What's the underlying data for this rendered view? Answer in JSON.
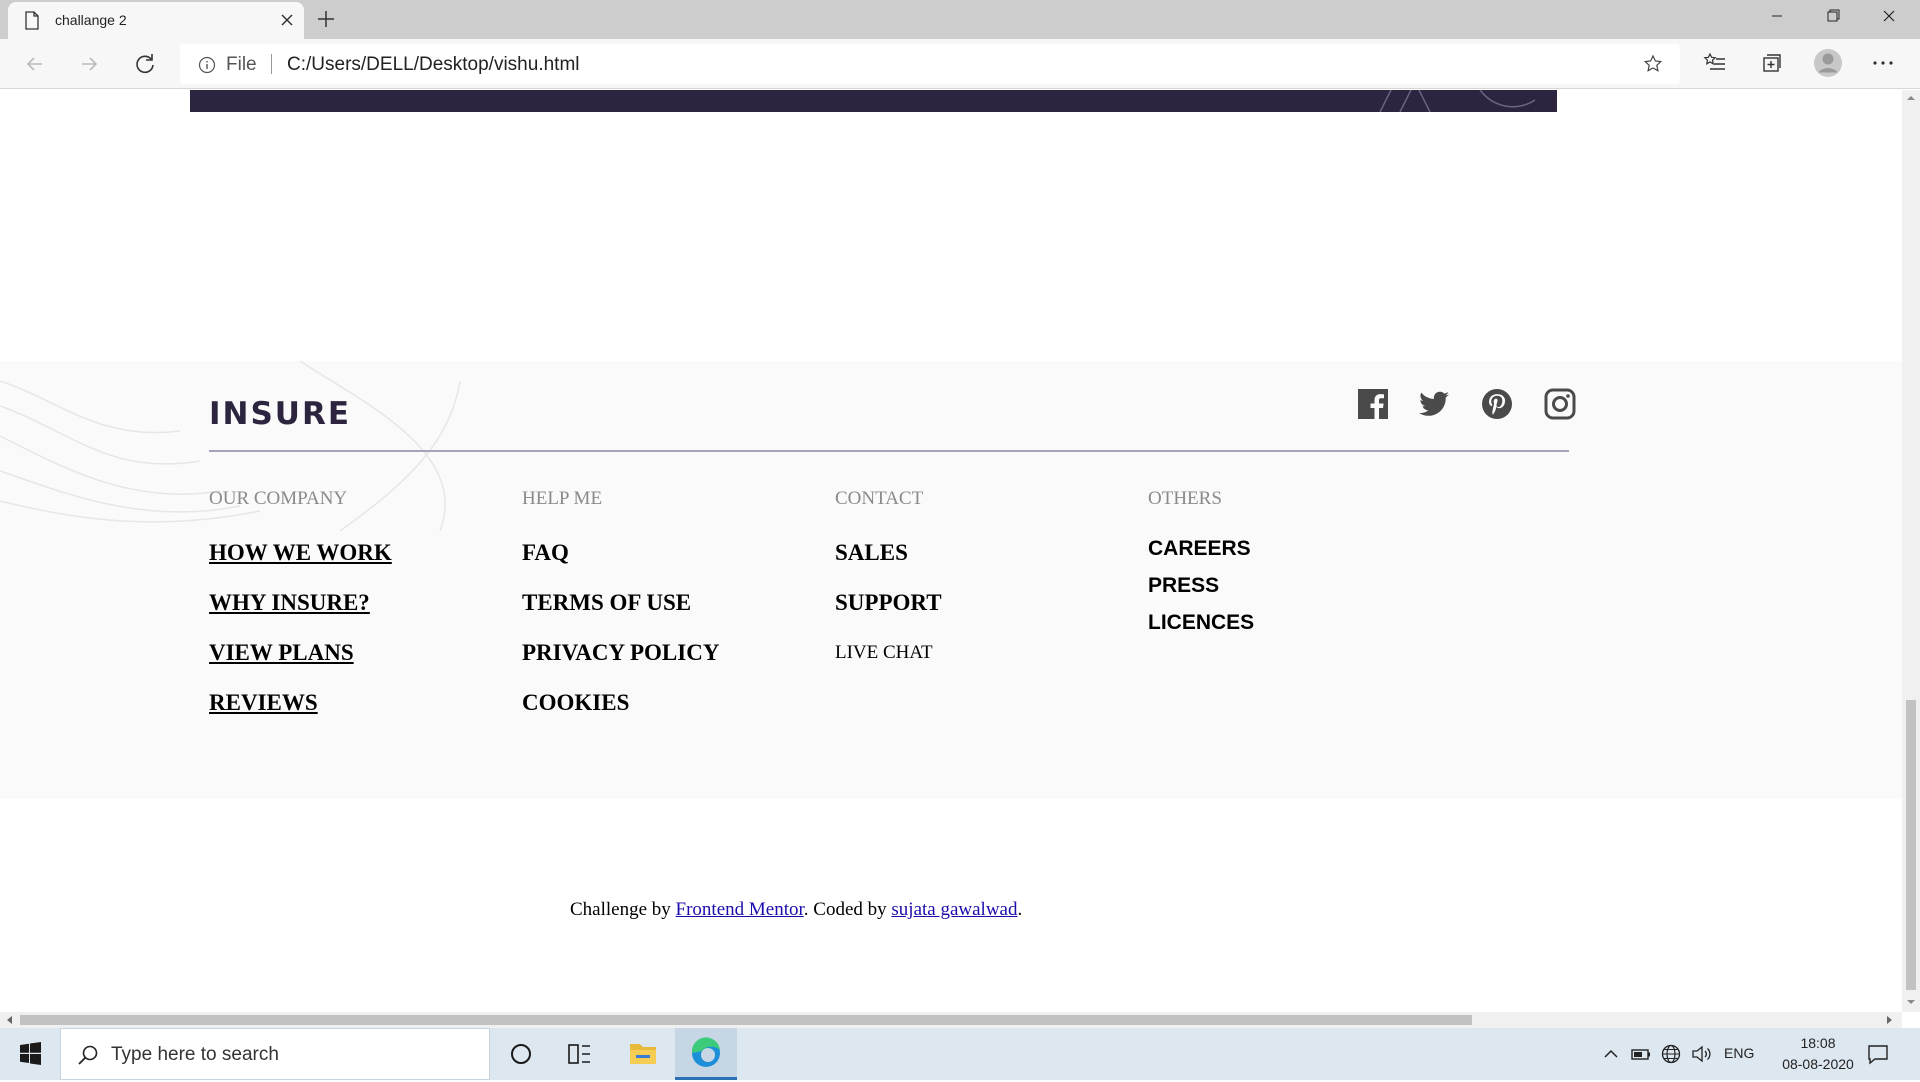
{
  "browser": {
    "tab_title": "challange 2",
    "address_scheme_label": "File",
    "url": "C:/Users/DELL/Desktop/vishu.html"
  },
  "page": {
    "logo": "INSURE",
    "footer_columns": [
      {
        "title": "OUR COMPANY",
        "links": [
          "HOW WE WORK",
          "WHY INSURE?",
          "VIEW PLANS",
          "REVIEWS"
        ]
      },
      {
        "title": "HELP ME",
        "links": [
          "FAQ",
          "TERMS OF USE",
          "PRIVACY POLICY",
          "COOKIES"
        ]
      },
      {
        "title": "CONTACT",
        "links": [
          "SALES",
          "SUPPORT",
          "LIVE CHAT"
        ]
      },
      {
        "title": "OTHERS",
        "links": [
          "CAREERS",
          "PRESS",
          "LICENCES"
        ]
      }
    ],
    "social_icons": [
      "facebook-icon",
      "twitter-icon",
      "pinterest-icon",
      "instagram-icon"
    ],
    "attribution": {
      "prefix": "Challenge by ",
      "link1": "Frontend Mentor",
      "middle": ". Coded by ",
      "link2": "sujata gawalwad",
      "suffix": "."
    },
    "colors": {
      "banner": "#2d2540",
      "logo": "#2d2540",
      "footer_bg": "#fafafa",
      "link": "#1a0dab"
    }
  },
  "taskbar": {
    "search_placeholder": "Type here to search",
    "language": "ENG",
    "time": "18:08",
    "date": "08-08-2020"
  }
}
